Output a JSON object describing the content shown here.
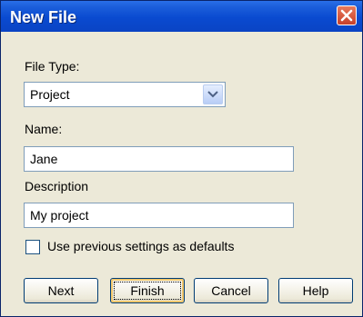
{
  "window": {
    "title": "New File",
    "close_icon": "close-icon"
  },
  "form": {
    "file_type_label": "File Type:",
    "file_type_value": "Project",
    "name_label": "Name:",
    "name_value": "Jane",
    "description_label": "Description",
    "description_value": "My project",
    "checkbox_label": "Use previous settings as defaults",
    "checkbox_checked": false
  },
  "buttons": {
    "next": "Next",
    "finish": "Finish",
    "cancel": "Cancel",
    "help": "Help"
  },
  "colors": {
    "titlebar": "#0a4ad0",
    "dialog_bg": "#ece9d8",
    "close_button": "#c8402a"
  }
}
